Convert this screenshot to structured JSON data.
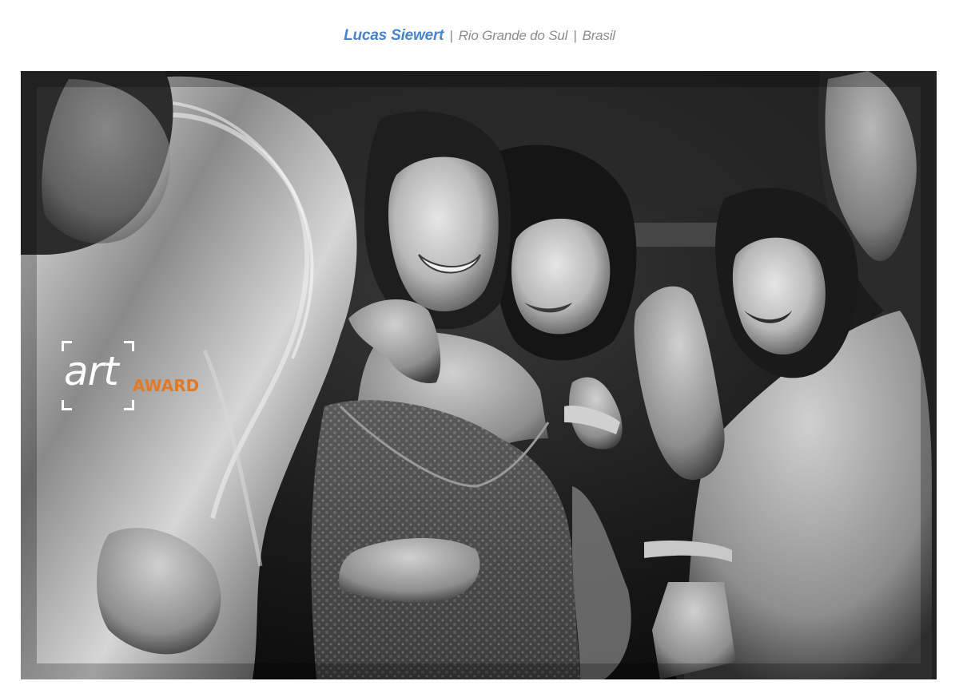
{
  "caption": {
    "name": "Lucas Siewert",
    "separator": "|",
    "region": "Rio Grande do Sul",
    "country": "Brasil"
  },
  "photo": {
    "subject": "black-and-white-celebration-photo"
  },
  "badge": {
    "art_text": "art",
    "award_text": "AWARD",
    "colors": {
      "art": "#ffffff",
      "award": "#e07a27"
    }
  },
  "colors": {
    "name": "#4a84c8",
    "location": "#8c8c8c",
    "background": "#ffffff"
  }
}
